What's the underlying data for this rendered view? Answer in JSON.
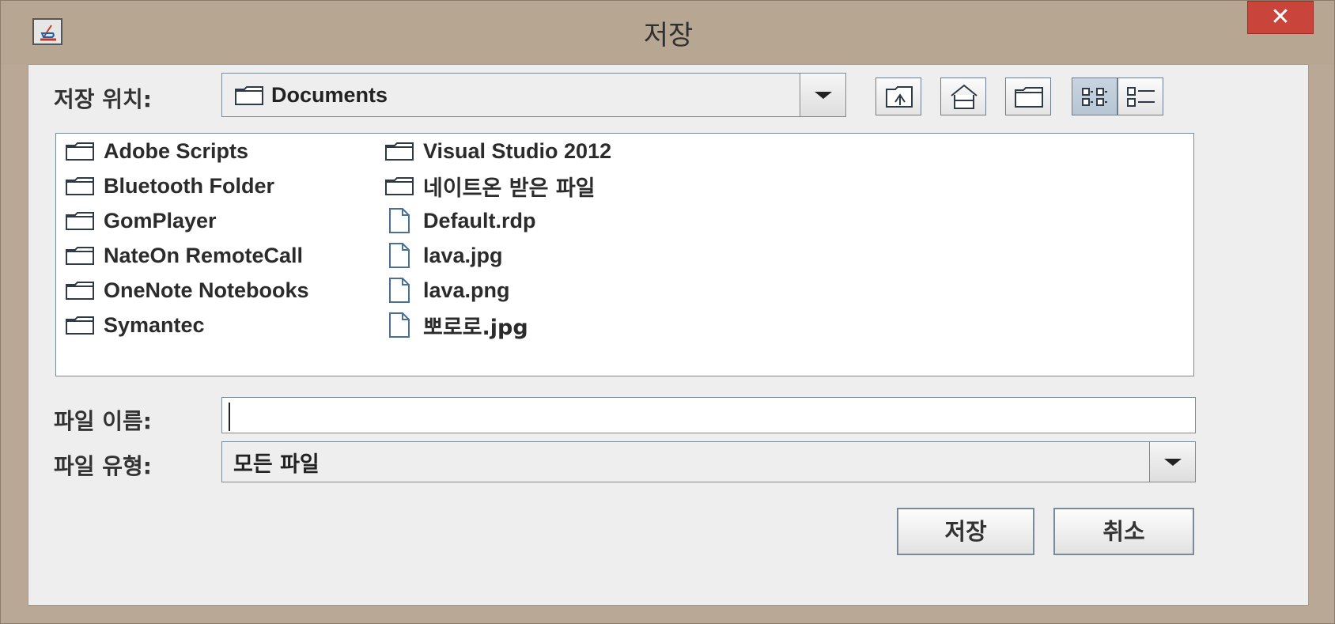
{
  "window": {
    "title": "저장",
    "close_label": "✕"
  },
  "save_in": {
    "label": "저장 위치:",
    "value": "Documents"
  },
  "toolbar": {
    "buttons": [
      {
        "name": "up-folder-icon"
      },
      {
        "name": "home-icon"
      },
      {
        "name": "new-folder-icon"
      },
      {
        "name": "list-view-icon"
      },
      {
        "name": "details-view-icon"
      }
    ]
  },
  "files": {
    "column1": [
      {
        "name": "Adobe Scripts",
        "type": "folder"
      },
      {
        "name": "Bluetooth Folder",
        "type": "folder"
      },
      {
        "name": "GomPlayer",
        "type": "folder"
      },
      {
        "name": "NateOn RemoteCall",
        "type": "folder"
      },
      {
        "name": "OneNote Notebooks",
        "type": "folder"
      },
      {
        "name": "Symantec",
        "type": "folder"
      }
    ],
    "column2": [
      {
        "name": "Visual Studio 2012",
        "type": "folder"
      },
      {
        "name": "네이트온 받은 파일",
        "type": "folder"
      },
      {
        "name": "Default.rdp",
        "type": "file"
      },
      {
        "name": "lava.jpg",
        "type": "file"
      },
      {
        "name": "lava.png",
        "type": "file"
      },
      {
        "name": "뽀로로.jpg",
        "type": "file"
      }
    ]
  },
  "filename": {
    "label": "파일 이름:",
    "value": ""
  },
  "filetype": {
    "label": "파일 유형:",
    "value": "모든 파일"
  },
  "buttons": {
    "save": "저장",
    "cancel": "취소"
  }
}
